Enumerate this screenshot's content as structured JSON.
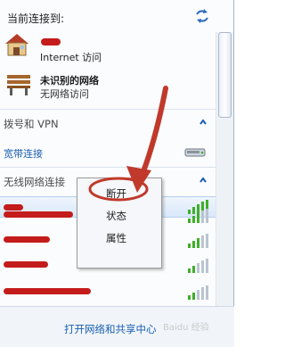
{
  "header": {
    "title": "当前连接到:"
  },
  "current_networks": [
    {
      "name": "",
      "sub": "Internet 访问"
    },
    {
      "name": "未识别的网络",
      "sub": "无网络访问"
    }
  ],
  "dialup": {
    "section_label": "拨号和 VPN",
    "items": [
      {
        "label": "宽带连接"
      }
    ]
  },
  "wireless": {
    "section_label": "无线网络连接"
  },
  "context_menu": {
    "items": [
      "断开",
      "状态",
      "属性"
    ]
  },
  "footer": {
    "link": "打开网络和共享中心"
  },
  "watermark": "Baidu 经验",
  "colors": {
    "link": "#1a5fb0",
    "annotation_red": "#c0392b",
    "signal_green": "#3fae2a"
  }
}
